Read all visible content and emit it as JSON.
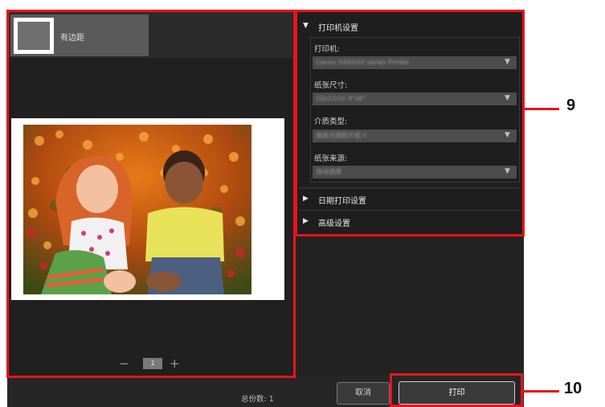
{
  "preview": {
    "thumb_label": "有边距",
    "page_minus": "−",
    "page_number": "1",
    "page_plus": "+"
  },
  "settings": {
    "printer_section": "打印机设置",
    "printer_label": "打印机:",
    "printer_value": "Canon XXXXXX series Printer",
    "paper_size_label": "纸张尺寸:",
    "paper_size_value": "10x15cm 4\"x6\"",
    "media_type_label": "介质类型:",
    "media_type_value": "高级光面照片纸 II",
    "paper_source_label": "纸张来源:",
    "paper_source_value": "自动选择",
    "date_section": "日期打印设置",
    "advanced_section": "高级设置"
  },
  "footer": {
    "total_label": "总份数: 1",
    "cancel_label": "取消",
    "print_label": "打印"
  },
  "callouts": {
    "settings_num": "9",
    "print_num": "10"
  },
  "colors": {
    "callout_red": "#e8141c",
    "panel_dark": "#222222"
  }
}
